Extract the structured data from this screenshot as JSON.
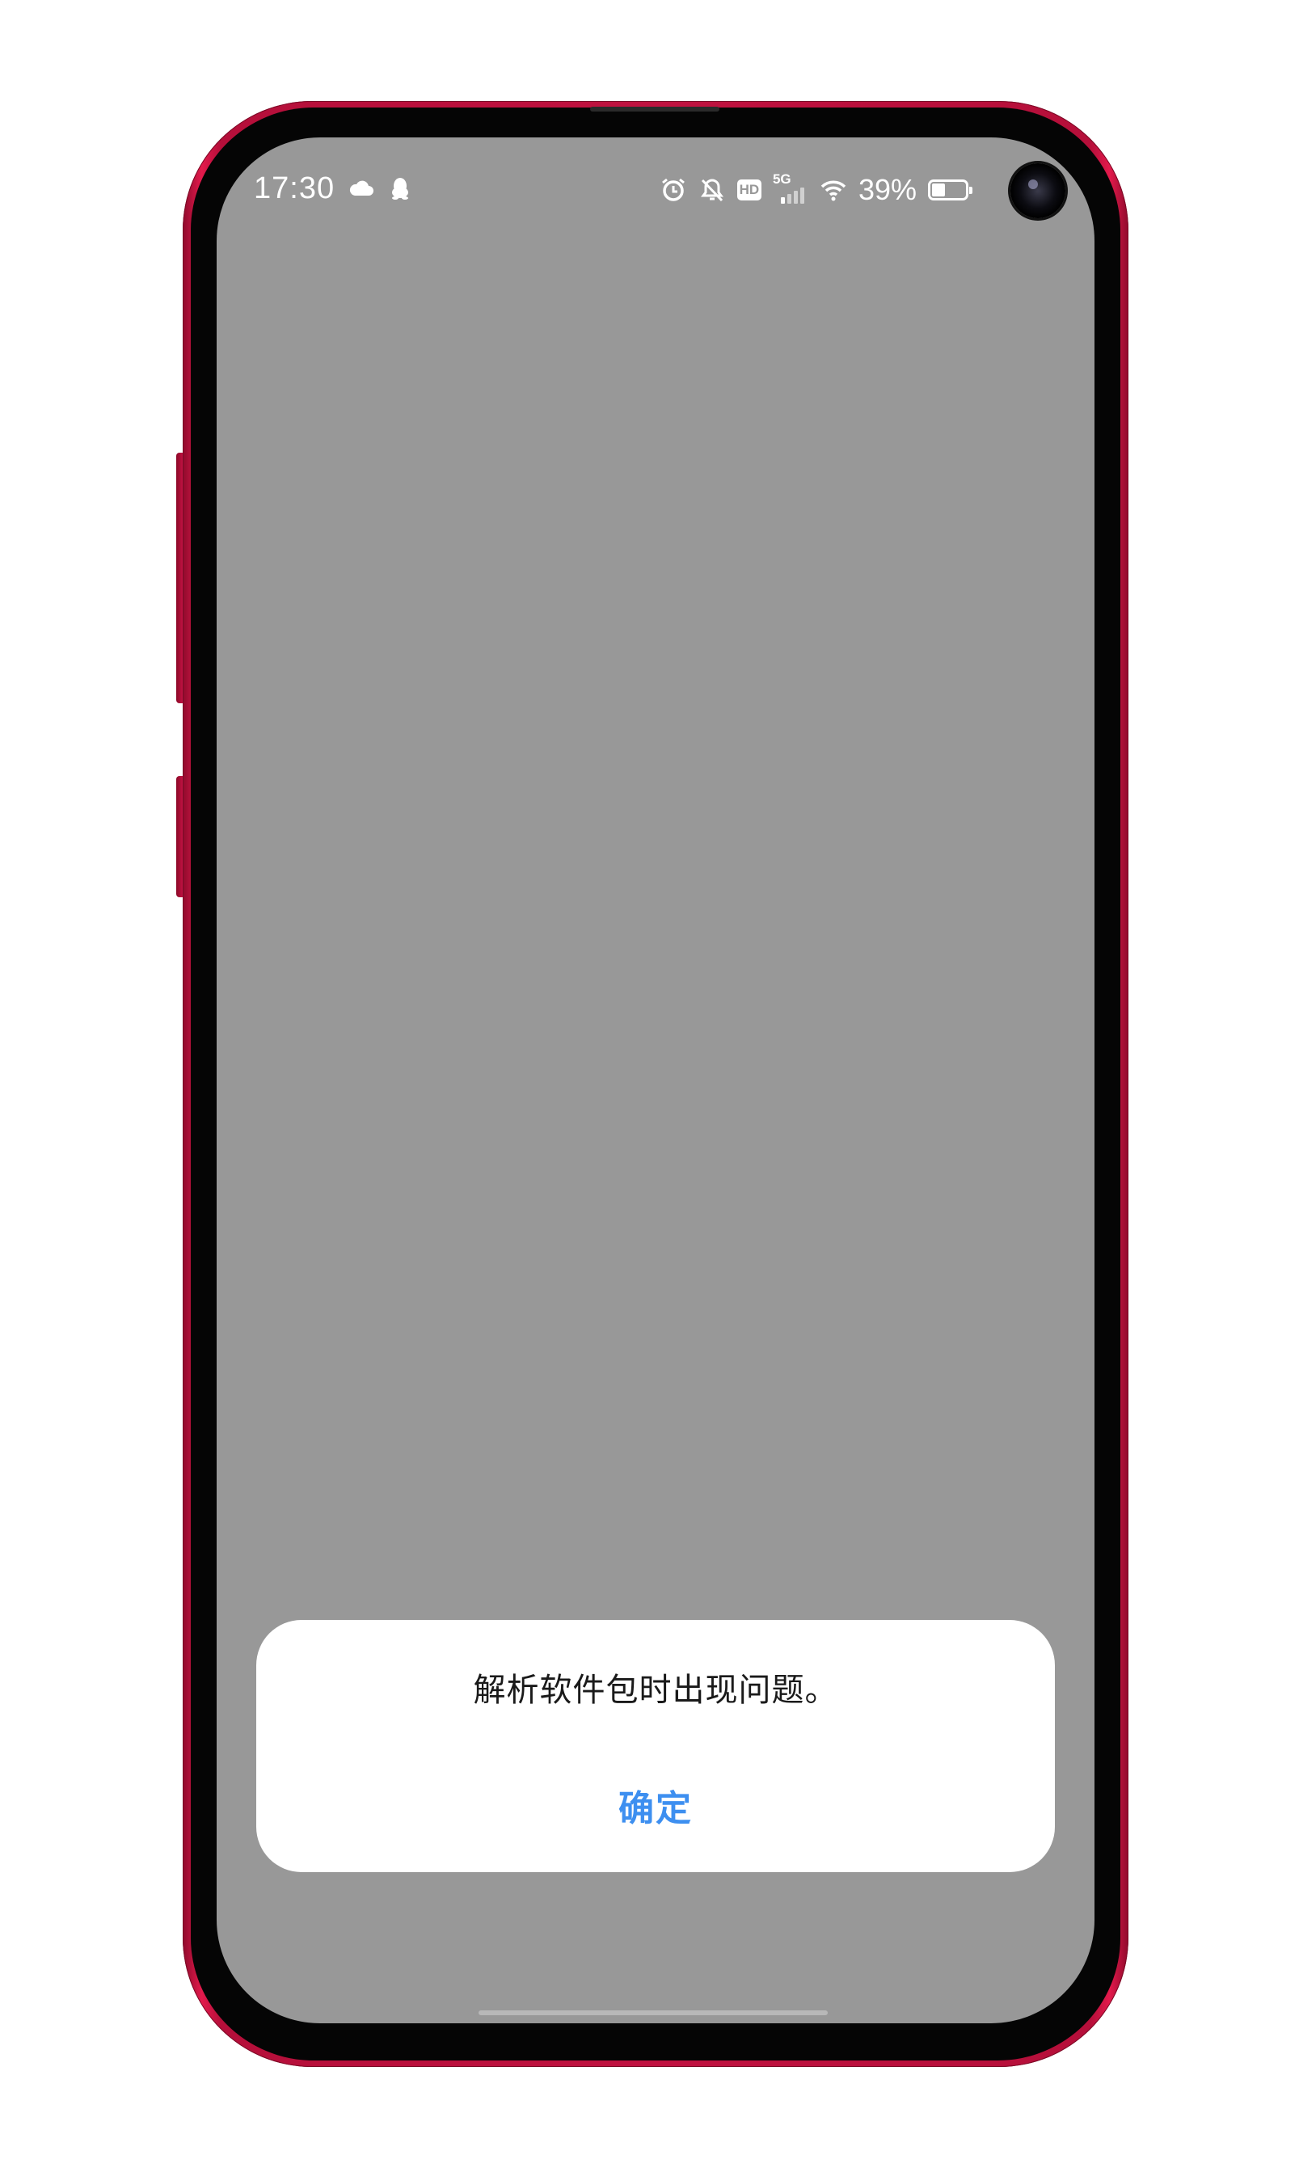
{
  "status_bar": {
    "time": "17:30",
    "network": "5G",
    "battery_percent": "39%",
    "battery_level": 0.39,
    "left_icons": [
      "cloud-icon",
      "qq-penguin-icon"
    ],
    "right_icons": [
      "alarm-icon",
      "mute-notification-icon",
      "hd-icon",
      "signal-5g-icon",
      "wifi-icon",
      "battery-icon"
    ],
    "hd_label": "HD"
  },
  "dialog": {
    "message": "解析软件包时出现问题。",
    "confirm_label": "确定"
  },
  "colors": {
    "screen_background": "#989898",
    "dialog_background": "#ffffff",
    "confirm_text": "#3d8ff0",
    "phone_body": "#c01240"
  }
}
